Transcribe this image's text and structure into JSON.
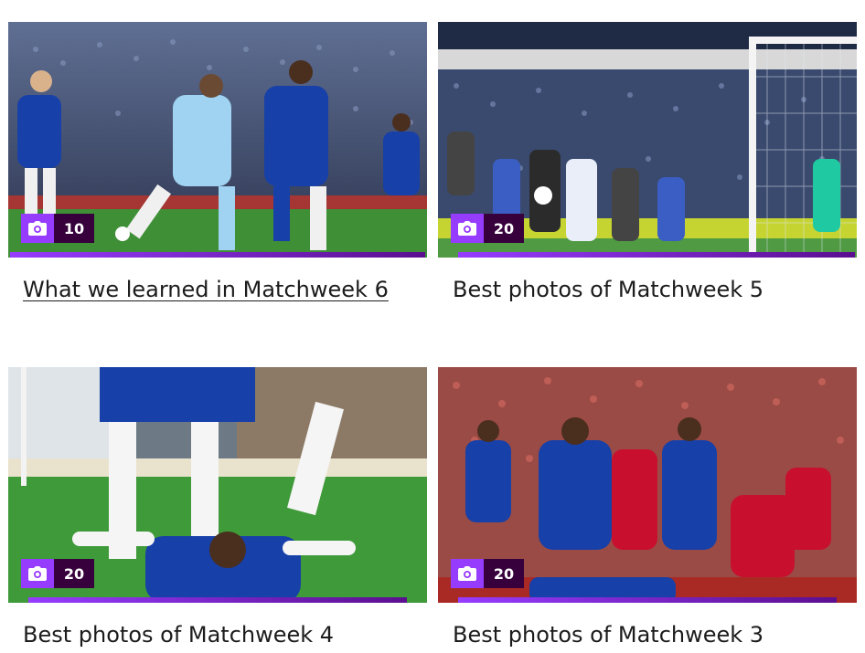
{
  "cards": [
    {
      "title": "What we learned in Matchweek 6",
      "photo_count": "10",
      "count_icon": "camera-icon",
      "hovered": true,
      "image_alt": "Manchester City and Chelsea players contesting the ball"
    },
    {
      "title": "Best photos of Matchweek 5",
      "photo_count": "20",
      "count_icon": "camera-icon",
      "hovered": false,
      "image_alt": "Goalmouth scramble in front of a packed stand"
    },
    {
      "title": "Best photos of Matchweek 4",
      "photo_count": "20",
      "count_icon": "camera-icon",
      "hovered": false,
      "image_alt": "Chelsea player celebrating on his back on the pitch"
    },
    {
      "title": "Best photos of Matchweek 3",
      "photo_count": "20",
      "count_icon": "camera-icon",
      "hovered": false,
      "image_alt": "Chelsea and Liverpool players awaiting a set piece"
    }
  ],
  "colors": {
    "badge_icon_bg": "#963cff",
    "badge_count_bg": "#37003c",
    "accent_bar": "#963cff",
    "title_text": "#1c1c1c"
  }
}
